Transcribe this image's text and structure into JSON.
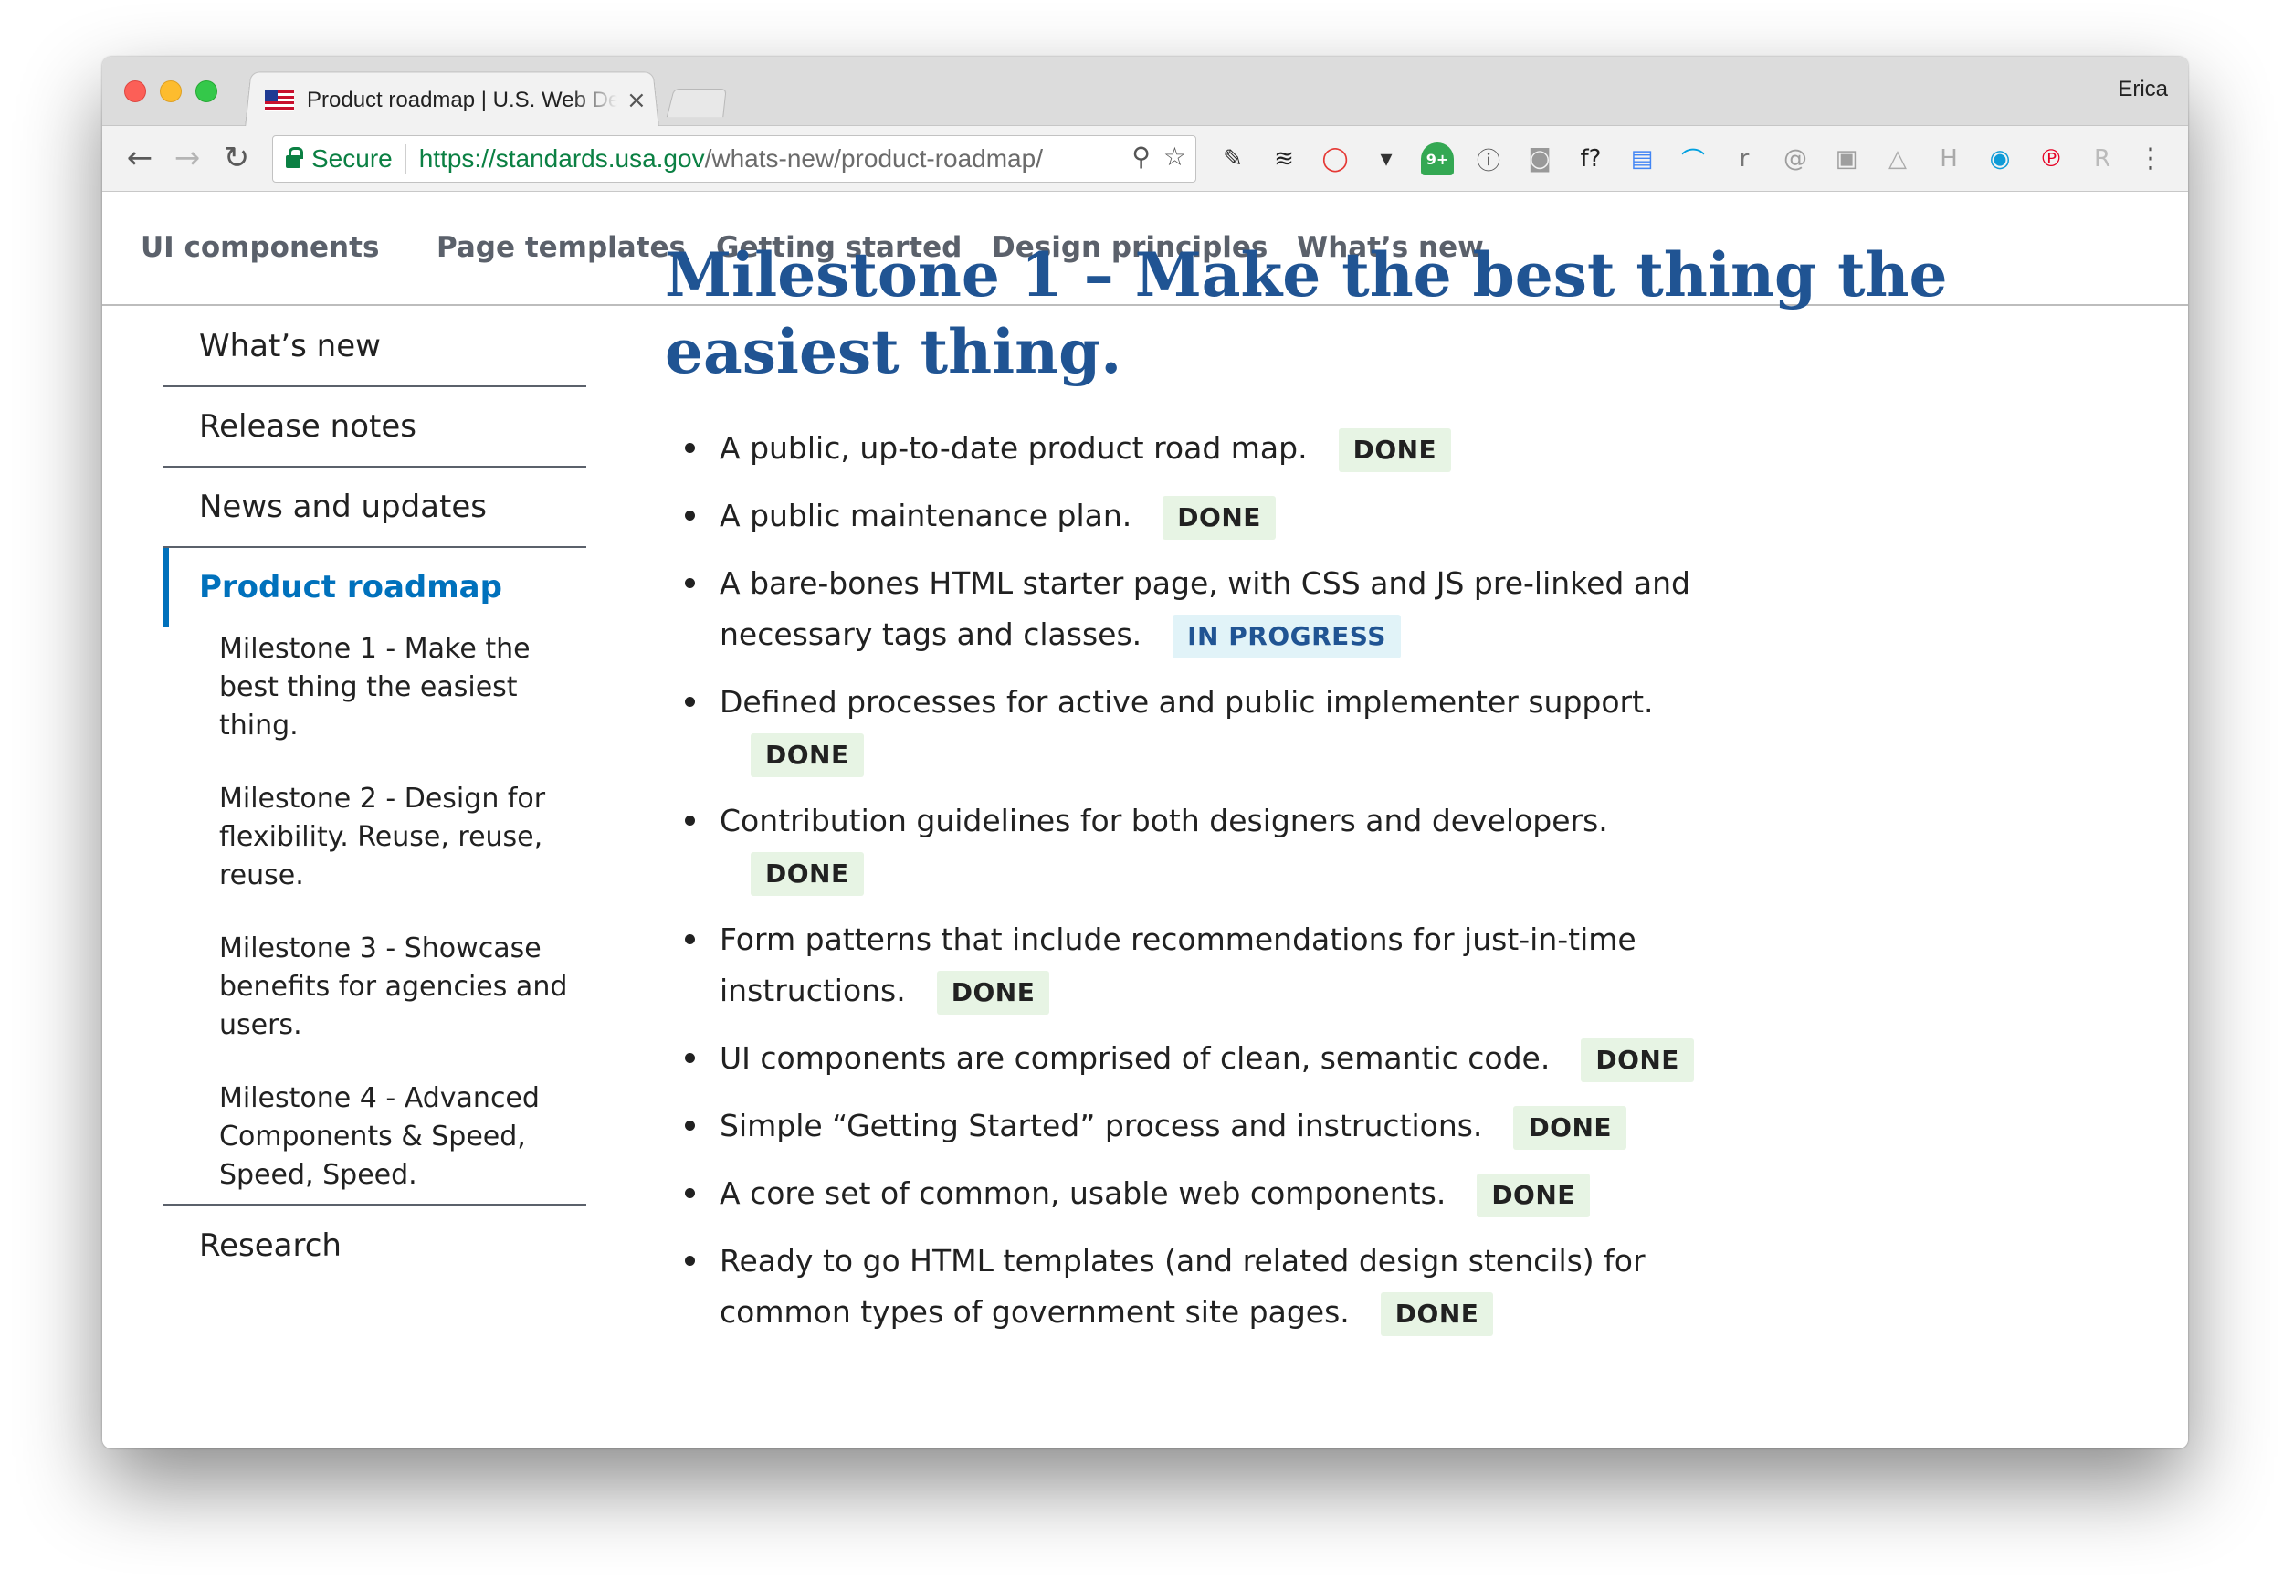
{
  "browser": {
    "tab_title": "Product roadmap | U.S. Web Design Standards",
    "tab_close": "×",
    "profile_name": "Erica",
    "secure_label": "Secure",
    "url_host": "https://standards.usa.gov",
    "url_path": "/whats-new/product-roadmap/",
    "back": "←",
    "forward": "→",
    "reload": "↻",
    "zoom_icon": "⚲",
    "star_icon": "☆",
    "menu": "⋮",
    "extensions": [
      {
        "name": "evernote-icon",
        "glyph": "✎",
        "color": "#2a2a2a"
      },
      {
        "name": "buffer-icon",
        "glyph": "≋",
        "color": "#222222"
      },
      {
        "name": "opera-icon",
        "glyph": "◯",
        "color": "#e53935"
      },
      {
        "name": "pocket-icon",
        "glyph": "▾",
        "color": "#333333"
      },
      {
        "name": "notification-badge-icon",
        "glyph": "9+",
        "color": "#34a853"
      },
      {
        "name": "onepassword-icon",
        "glyph": "ⓘ",
        "color": "#555555"
      },
      {
        "name": "camera-icon",
        "glyph": "◙",
        "color": "#999999"
      },
      {
        "name": "font-icon",
        "glyph": "f?",
        "color": "#222222"
      },
      {
        "name": "doc-icon",
        "glyph": "▤",
        "color": "#4285f4"
      },
      {
        "name": "rainbow-icon",
        "glyph": "⌒",
        "color": "#00a0e0"
      },
      {
        "name": "r-icon",
        "glyph": "r",
        "color": "#777777"
      },
      {
        "name": "at-icon",
        "glyph": "@",
        "color": "#9e9e9e"
      },
      {
        "name": "square-icon",
        "glyph": "▣",
        "color": "#9e9e9e"
      },
      {
        "name": "drive-icon",
        "glyph": "△",
        "color": "#aaaaaa"
      },
      {
        "name": "h-icon",
        "glyph": "H",
        "color": "#aaaaaa"
      },
      {
        "name": "circle-icon",
        "glyph": "◉",
        "color": "#0f9bd7"
      },
      {
        "name": "pinterest-icon",
        "glyph": "℗",
        "color": "#e60023"
      },
      {
        "name": "reader-icon",
        "glyph": "R",
        "color": "#bbbbbb"
      }
    ]
  },
  "topnav": [
    {
      "label": "UI components"
    },
    {
      "label": "Page templates"
    },
    {
      "label": "Getting started"
    },
    {
      "label": "Design principles"
    },
    {
      "label": "What’s new"
    }
  ],
  "sidenav": {
    "items_before": [
      "What’s new",
      "Release notes",
      "News and updates"
    ],
    "current": "Product roadmap",
    "sub_items": [
      "Milestone 1 - Make the best thing the easiest thing.",
      "Milestone 2 - Design for flexibility. Reuse, reuse, reuse.",
      "Milestone 3 - Showcase benefits for agencies and users.",
      "Milestone 4 - Advanced Components & Speed, Speed, Speed."
    ],
    "items_after": [
      "Research"
    ]
  },
  "main": {
    "title": "Milestone 1 – Make the best thing the easiest thing.",
    "tasks": [
      {
        "text": "A public, up-to-date product road map.",
        "status": "DONE"
      },
      {
        "text": "A public maintenance plan.",
        "status": "DONE"
      },
      {
        "text": "A bare-bones HTML starter page, with CSS and JS pre-linked and necessary tags and classes.",
        "status": "IN PROGRESS"
      },
      {
        "text": "Defined processes for active and public implementer support.",
        "status": "DONE"
      },
      {
        "text": "Contribution guidelines for both designers and developers.",
        "status": "DONE"
      },
      {
        "text": "Form patterns that include recommendations for just-in-time instructions.",
        "status": "DONE"
      },
      {
        "text": "UI components are comprised of clean, semantic code.",
        "status": "DONE"
      },
      {
        "text": "Simple “Getting Started” process and instructions.",
        "status": "DONE"
      },
      {
        "text": "A core set of common, usable web components.",
        "status": "DONE"
      },
      {
        "text": "Ready to go HTML templates (and related design stencils) for common types of government site pages.",
        "status": "DONE"
      }
    ]
  },
  "colors": {
    "accent": "#0071bc",
    "title": "#205493",
    "done_bg": "#e7f4e4",
    "progress_bg": "#e1f3f8"
  }
}
